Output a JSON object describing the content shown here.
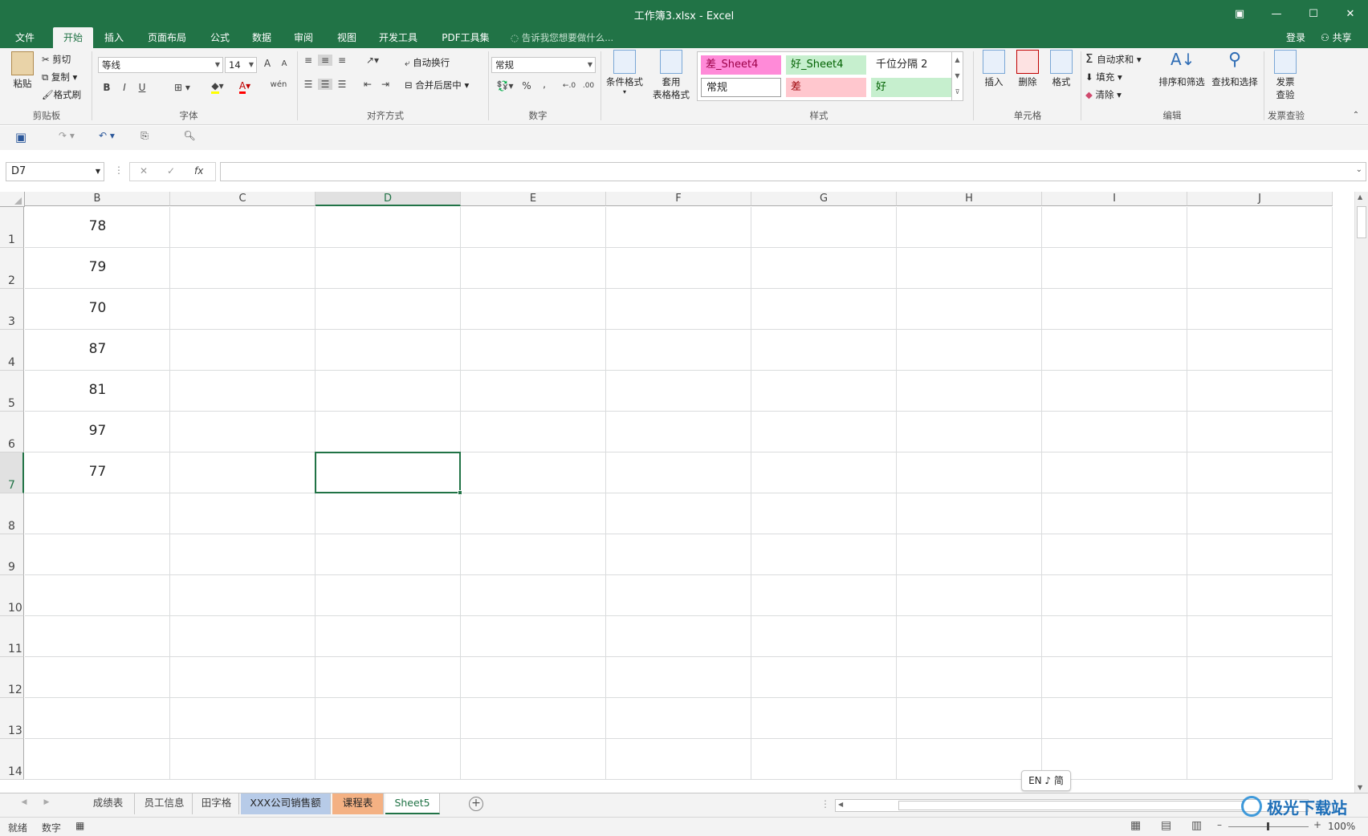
{
  "window": {
    "title": "工作簿3.xlsx - Excel",
    "restore_icon": "▣",
    "minimize": "—",
    "maximize": "☐",
    "close": "✕"
  },
  "ribbon_tabs": [
    {
      "label": "文件"
    },
    {
      "label": "开始",
      "active": true
    },
    {
      "label": "插入"
    },
    {
      "label": "页面布局"
    },
    {
      "label": "公式"
    },
    {
      "label": "数据"
    },
    {
      "label": "审阅"
    },
    {
      "label": "视图"
    },
    {
      "label": "开发工具"
    },
    {
      "label": "PDF工具集"
    }
  ],
  "tellme": "告诉我您想要做什么...",
  "account": {
    "login": "登录",
    "share": "共享"
  },
  "clipboard": {
    "paste": "粘贴",
    "cut": "剪切",
    "copy": "复制",
    "format_painter": "格式刷",
    "group": "剪贴板"
  },
  "font": {
    "name": "等线",
    "size": "14",
    "bold": "B",
    "italic": "I",
    "underline": "U",
    "group": "字体",
    "grow": "A",
    "shrink": "A",
    "phonetic": "wén"
  },
  "alignment": {
    "wrap": "自动换行",
    "merge": "合并后居中",
    "group": "对齐方式"
  },
  "number": {
    "format": "常规",
    "percent": "%",
    "comma": ",",
    "inc": "←.0",
    "dec": ".00",
    "group": "数字"
  },
  "styles": {
    "cond": "条件格式",
    "table_fmt_line1": "套用",
    "table_fmt_line2": "表格格式",
    "group": "样式",
    "cells": [
      {
        "label": "差_Sheet4",
        "bg": "#ff8ad8",
        "fg": "#9c0047"
      },
      {
        "label": "好_Sheet4",
        "bg": "#c6efce",
        "fg": "#006100"
      },
      {
        "label": "千位分隔 2",
        "bg": "#ffffff",
        "fg": "#262626"
      },
      {
        "label": "常规",
        "bg": "#ffffff",
        "fg": "#262626"
      },
      {
        "label": "差",
        "bg": "#ffc7ce",
        "fg": "#9c0006"
      },
      {
        "label": "好",
        "bg": "#c6efce",
        "fg": "#006100"
      }
    ]
  },
  "cells_group": {
    "insert": "插入",
    "delete": "删除",
    "format": "格式",
    "group": "单元格"
  },
  "editing": {
    "autosum": "自动求和",
    "fill": "填充",
    "clear": "清除",
    "sort": "排序和筛选",
    "find": "查找和选择",
    "group": "编辑"
  },
  "invoice": {
    "line1": "发票",
    "line2": "查验",
    "group": "发票查验"
  },
  "namebox": "D7",
  "columns": [
    "B",
    "C",
    "D",
    "E",
    "F",
    "G",
    "H",
    "I",
    "J"
  ],
  "selected_column": "D",
  "rows": [
    "1",
    "2",
    "3",
    "4",
    "5",
    "6",
    "7",
    "8",
    "9",
    "10",
    "11",
    "12",
    "13",
    "14"
  ],
  "selected_row": "7",
  "column_b_values": [
    "78",
    "79",
    "70",
    "87",
    "81",
    "97",
    "77"
  ],
  "ime": "EN ♪ 简",
  "sheets": [
    {
      "label": "成绩表",
      "bg": "#f3f3f3",
      "fg": "#444"
    },
    {
      "label": "员工信息",
      "bg": "#f3f3f3",
      "fg": "#444"
    },
    {
      "label": "田字格",
      "bg": "#f3f3f3",
      "fg": "#444"
    },
    {
      "label": "XXX公司销售额",
      "bg": "#b7cbe8",
      "fg": "#262626"
    },
    {
      "label": "课程表",
      "bg": "#f4b183",
      "fg": "#262626"
    },
    {
      "label": "Sheet5",
      "bg": "#ffffff",
      "fg": "#217346",
      "active": true
    }
  ],
  "status": {
    "ready": "就绪",
    "mode": "数字",
    "zoom": "100%"
  },
  "watermark": "极光下载站"
}
